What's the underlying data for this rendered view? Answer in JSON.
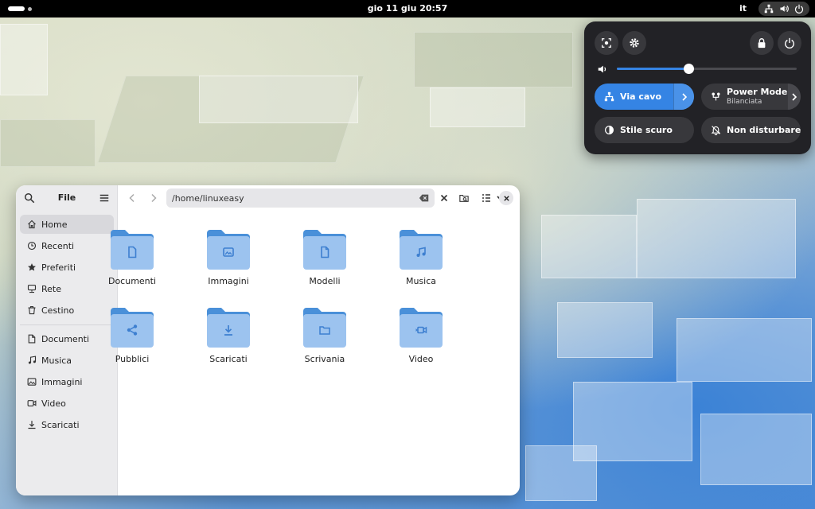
{
  "topbar": {
    "clock": "gio 11 giu  20:57",
    "language": "it",
    "tray_icons": [
      "network-wired-icon",
      "volume-icon",
      "power-icon"
    ]
  },
  "quick_settings": {
    "buttons": [
      "screenshot-icon",
      "settings-icon",
      "lock-icon",
      "power-icon"
    ],
    "volume_level": 0.4,
    "tiles": [
      {
        "label": "Via cavo",
        "subtitle": "",
        "icon": "network-wired-icon",
        "active": true,
        "has_arrow": true
      },
      {
        "label": "Power Mode",
        "subtitle": "Bilanciata",
        "icon": "power-profile-icon",
        "active": false,
        "has_arrow": true
      },
      {
        "label": "Stile scuro",
        "subtitle": "",
        "icon": "dark-style-icon",
        "active": false,
        "has_arrow": false
      },
      {
        "label": "Non disturbare",
        "subtitle": "",
        "icon": "bell-off-icon",
        "active": false,
        "has_arrow": false
      }
    ]
  },
  "file_manager": {
    "title": "File",
    "path": "/home/linuxeasy",
    "sidebar": {
      "places": [
        {
          "label": "Home",
          "icon": "home-icon",
          "selected": true
        },
        {
          "label": "Recenti",
          "icon": "clock-icon",
          "selected": false
        },
        {
          "label": "Preferiti",
          "icon": "star-icon",
          "selected": false
        },
        {
          "label": "Rete",
          "icon": "network-icon",
          "selected": false
        },
        {
          "label": "Cestino",
          "icon": "trash-icon",
          "selected": false
        }
      ],
      "bookmarks": [
        {
          "label": "Documenti",
          "icon": "document-icon"
        },
        {
          "label": "Musica",
          "icon": "music-icon"
        },
        {
          "label": "Immagini",
          "icon": "image-icon"
        },
        {
          "label": "Video",
          "icon": "video-icon"
        },
        {
          "label": "Scaricati",
          "icon": "download-icon"
        }
      ]
    },
    "folders": [
      {
        "name": "Documenti",
        "glyph": "document-icon"
      },
      {
        "name": "Immagini",
        "glyph": "image-icon"
      },
      {
        "name": "Modelli",
        "glyph": "template-icon"
      },
      {
        "name": "Musica",
        "glyph": "music-icon"
      },
      {
        "name": "Pubblici",
        "glyph": "share-icon"
      },
      {
        "name": "Scaricati",
        "glyph": "download-icon"
      },
      {
        "name": "Scrivania",
        "glyph": "folder-icon"
      },
      {
        "name": "Video",
        "glyph": "video-icon"
      }
    ]
  },
  "colors": {
    "accent": "#3584e4",
    "folder_back": "#4a90d9",
    "folder_front": "#9cc3ef",
    "folder_glyph": "#3d7fd0",
    "panel_bg": "#222226"
  }
}
